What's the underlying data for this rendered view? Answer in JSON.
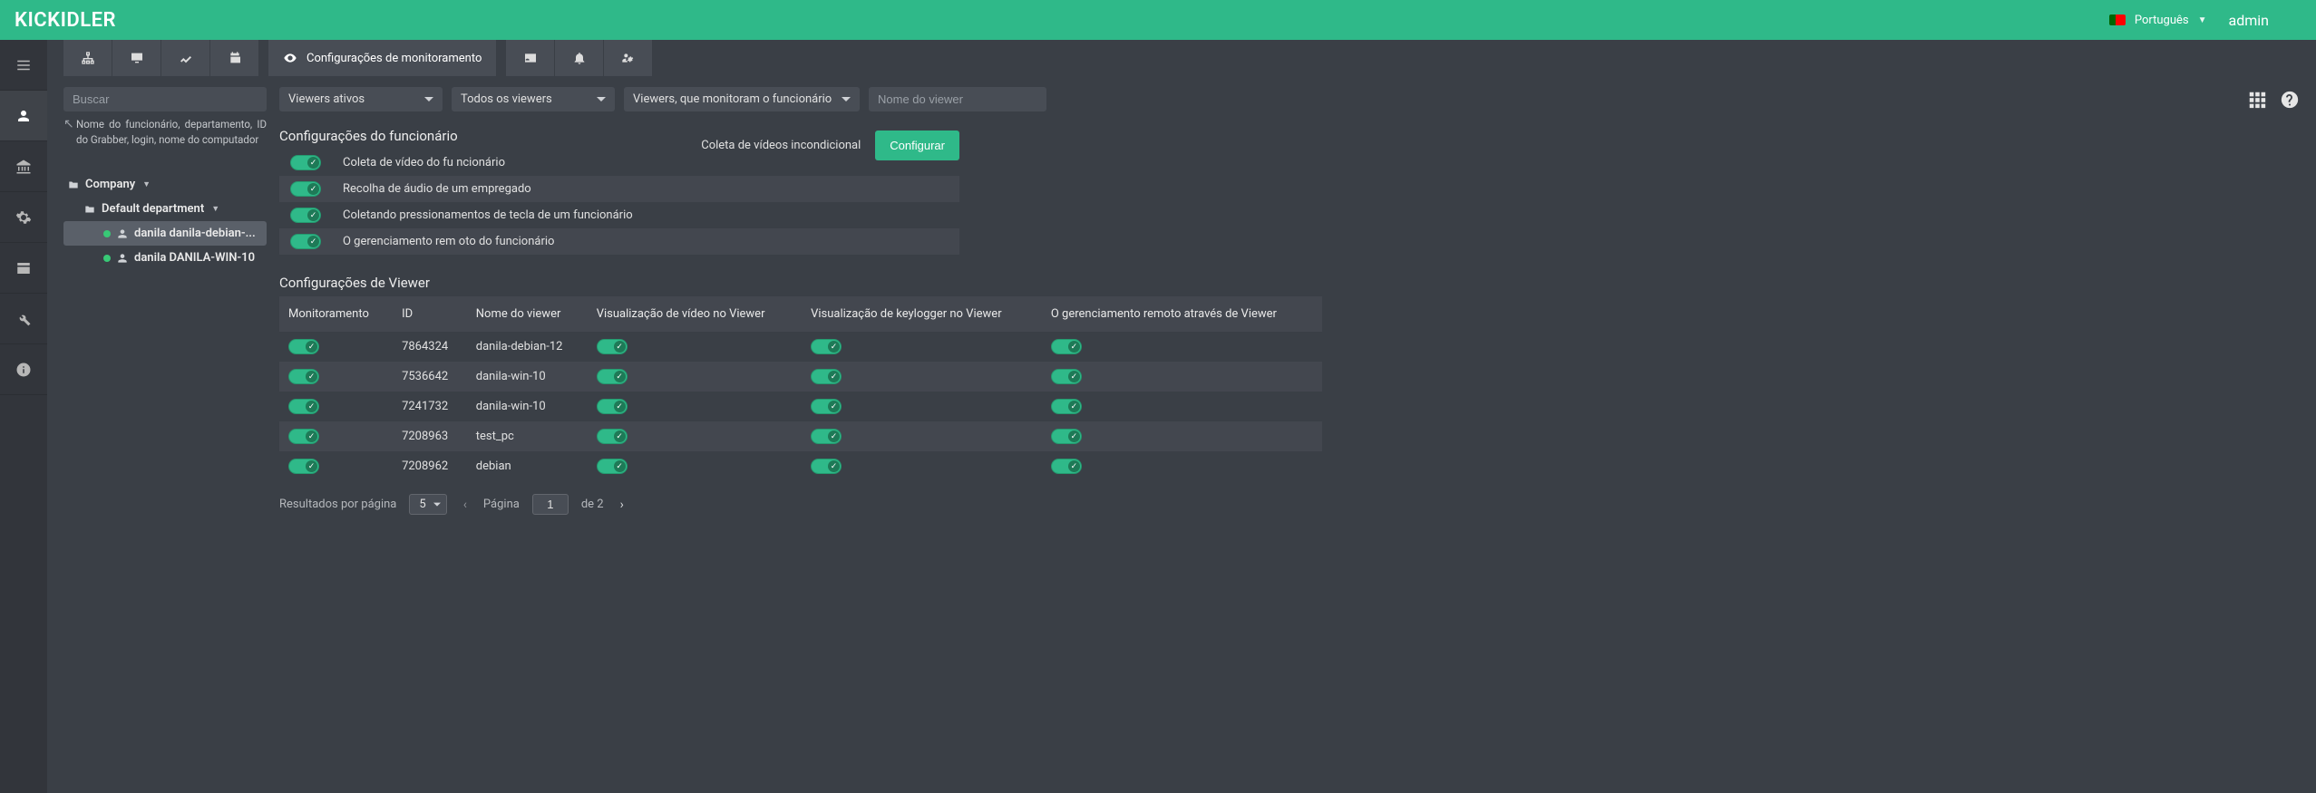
{
  "brand": "KICKIDLER",
  "topbar": {
    "language": "Português",
    "user": "admin"
  },
  "iconbar": {
    "main_tab": "Configurações de monitoramento"
  },
  "search": {
    "placeholder": "Buscar",
    "hint": "Nome do funcionário, departamento, ID do Grabber, login, nome do computador"
  },
  "filters": {
    "d1": "Viewers ativos",
    "d2": "Todos os viewers",
    "d3": "Viewers, que monitoram o funcionário",
    "viewer_name_placeholder": "Nome do viewer"
  },
  "tree": {
    "root": "Company",
    "dept": "Default department",
    "emp1": "danila danila-debian-...",
    "emp2": "danila DANILA-WIN-10"
  },
  "sections": {
    "employee": "Configurações do funcionário",
    "viewer": "Configurações de Viewer"
  },
  "employeeSettings": [
    "Coleta de vídeo do fu ncionário",
    "Recolha de áudio de um empregado",
    "Coletando pressionamentos de tecla de um funcionário",
    "O gerenciamento rem oto do funcionário"
  ],
  "unconditional": {
    "label": "Coleta de vídeos incondicional",
    "button": "Configurar"
  },
  "table": {
    "headers": {
      "monitoring": "Monitoramento",
      "id": "ID",
      "name": "Nome do viewer",
      "video": "Visualização de vídeo no Viewer",
      "keylogger": "Visualização de keylogger no Viewer",
      "remote": "O gerenciamento remoto através de Viewer"
    },
    "rows": [
      {
        "id": "7864324",
        "name": "danila-debian-12"
      },
      {
        "id": "7536642",
        "name": "danila-win-10"
      },
      {
        "id": "7241732",
        "name": "danila-win-10"
      },
      {
        "id": "7208963",
        "name": "test_pc"
      },
      {
        "id": "7208962",
        "name": "debian"
      }
    ]
  },
  "pagination": {
    "results_label": "Resultados por página",
    "per_page": "5",
    "page_label": "Página",
    "current": "1",
    "total_label": "de 2"
  }
}
